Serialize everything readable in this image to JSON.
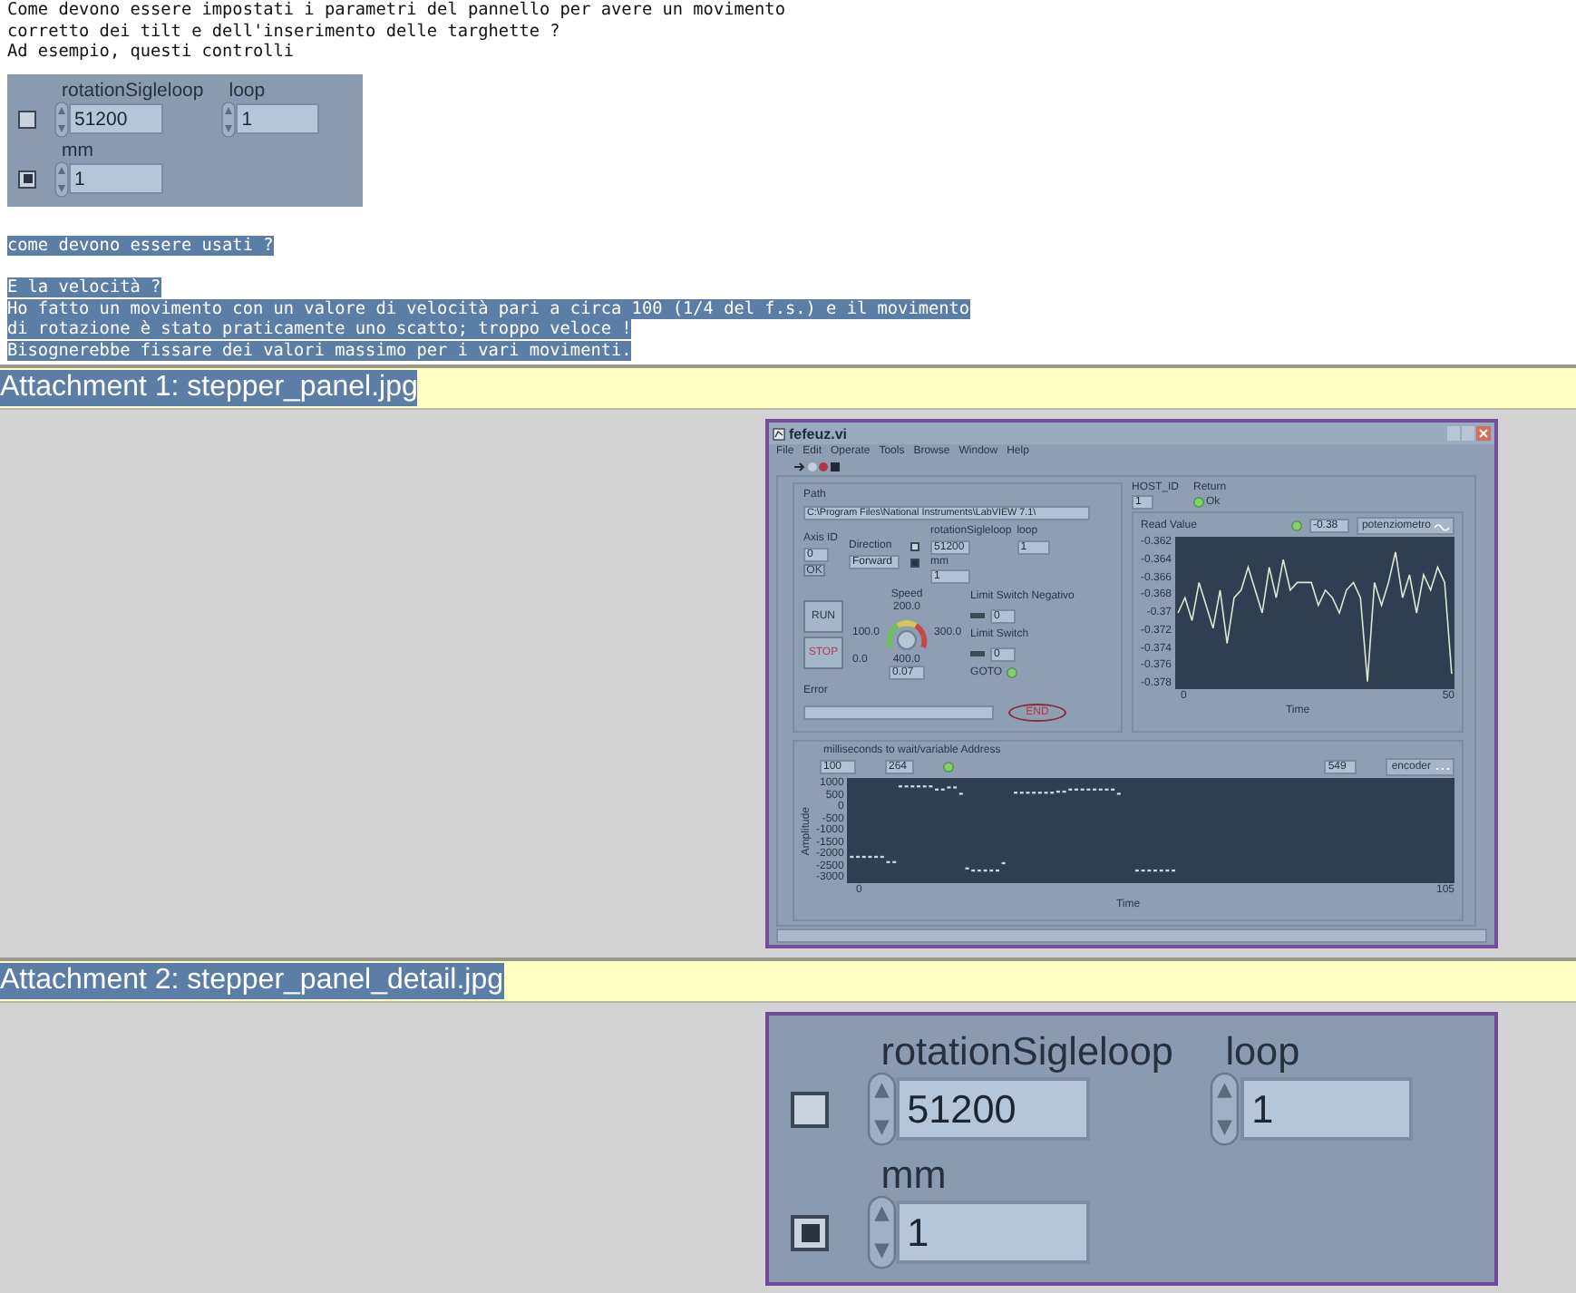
{
  "message_lines": [
    {
      "text": "Come devono essere impostati i parametri del pannello per avere un movimento",
      "selected": false
    },
    {
      "text": "corretto dei tilt e dell'inserimento delle targhette ?",
      "selected": false
    },
    {
      "text": "Ad esempio, questi controlli",
      "selected": false
    }
  ],
  "inline_panel": {
    "checkboxes": [
      {
        "checked": false
      },
      {
        "checked": true
      }
    ],
    "controls": [
      {
        "label": "rotationSigleloop",
        "value": "51200"
      },
      {
        "label": "loop",
        "value": "1"
      },
      {
        "label": "mm",
        "value": "1"
      }
    ]
  },
  "question_paragraphs": [
    [
      {
        "text": "come devono essere usati ?",
        "selected": true
      }
    ],
    [
      {
        "text": "E la velocità ?",
        "selected": true
      },
      {
        "text": "Ho fatto un movimento con un valore di velocità pari a circa 100 (1/4 del f.s.) e il movimento",
        "selected": true
      },
      {
        "text": "di rotazione è stato praticamente uno scatto; troppo veloce !",
        "selected": true
      },
      {
        "text": "Bisognerebbe fissare dei valori massimo per i vari movimenti.",
        "selected": true
      }
    ]
  ],
  "attachments": [
    {
      "kind": "window",
      "title": "Attachment 1: stepper_panel.jpg",
      "selected": true,
      "window": {
        "title": "fefeuz.vi",
        "menu": [
          "File",
          "Edit",
          "Operate",
          "Tools",
          "Browse",
          "Window",
          "Help"
        ],
        "path_label": "Path",
        "path_value": "C:\\Program Files\\National Instruments\\LabVIEW 7.1\\",
        "axis_label": "Axis ID",
        "axis_value": "0",
        "ok_button": "OK",
        "direction_label": "Direction",
        "direction_value": "Forward",
        "checkboxes": [
          {
            "checked": false
          },
          {
            "checked": true
          }
        ],
        "controls": [
          {
            "label": "rotationSigleloop",
            "value": "51200"
          },
          {
            "label": "loop",
            "value": "1"
          },
          {
            "label": "mm",
            "value": "1"
          }
        ],
        "buttons": [
          "RUN",
          "STOP"
        ],
        "speed_label": "Speed",
        "gauge_labels": [
          "200.0",
          "100.0",
          "300.0",
          "0.0",
          "400.0"
        ],
        "speed_value": "0.07",
        "goto_label": "GOTO",
        "limit_neg_label": "Limit Switch Negativo",
        "limit_neg_value": "0",
        "limit_label": "Limit Switch",
        "limit_value": "0",
        "error_label": "Error",
        "end_button": "END",
        "host_label": "HOST_ID",
        "host_value": "1",
        "return_label": "Return",
        "return_value": "Ok",
        "read_chart": {
          "title": "Read Value",
          "value": "-0.38",
          "legend": "potenziometro",
          "yticks": [
            "-0.362",
            "-0.364",
            "-0.366",
            "-0.368",
            "-0.37",
            "-0.372",
            "-0.374",
            "-0.376",
            "-0.378"
          ],
          "xticks": [
            "0",
            "50"
          ],
          "xlabel": "Time"
        },
        "wait_label": "milliseconds to wait/variable Address",
        "wait_value": "100",
        "address_value": "264",
        "encoder_chart": {
          "value": "549",
          "legend": "encoder",
          "ylabel": "Amplitude",
          "yticks": [
            "1000",
            "500",
            "0",
            "-500",
            "-1000",
            "-1500",
            "-2000",
            "-2500",
            "-3000"
          ],
          "xticks": [
            "0",
            "105"
          ],
          "xlabel": "Time"
        }
      }
    },
    {
      "kind": "panel",
      "title": "Attachment 2: stepper_panel_detail.jpg",
      "selected": true,
      "panel": {
        "checkboxes": [
          {
            "checked": false
          },
          {
            "checked": true
          }
        ],
        "controls": [
          {
            "label": "rotationSigleloop",
            "value": "51200"
          },
          {
            "label": "loop",
            "value": "1"
          },
          {
            "label": "mm",
            "value": "1"
          }
        ]
      }
    }
  ]
}
